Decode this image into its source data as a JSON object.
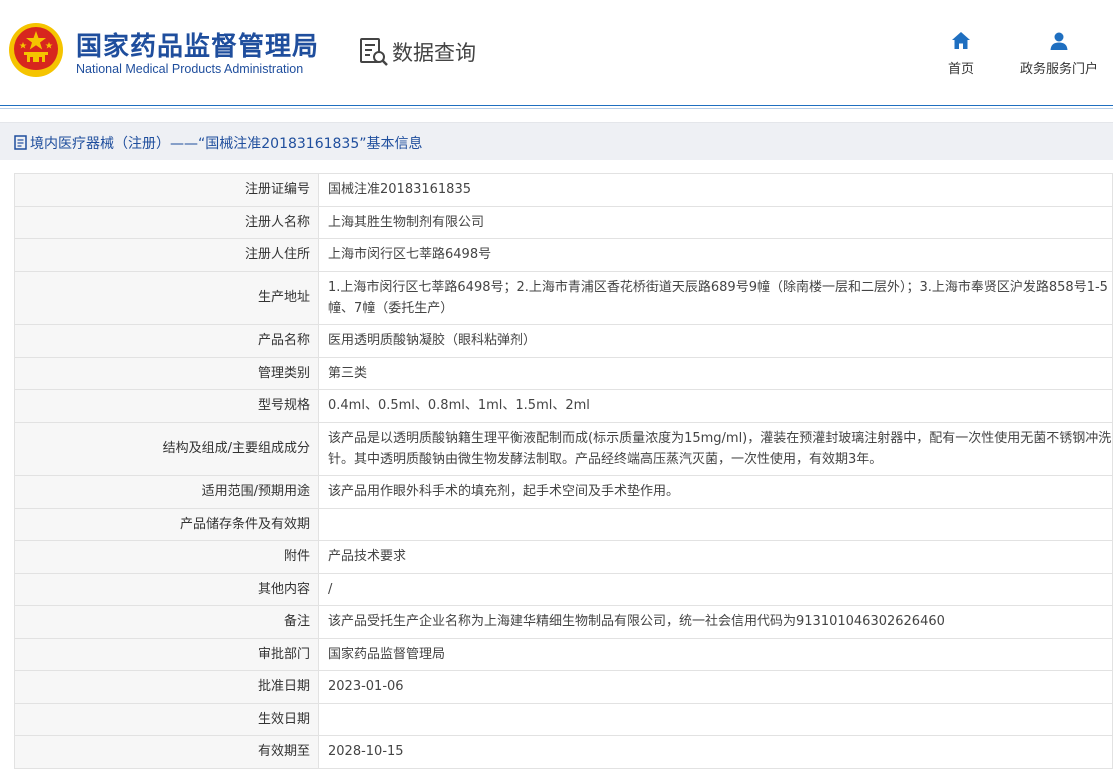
{
  "header": {
    "site_title_cn": "国家药品监督管理局",
    "site_title_en": "National Medical Products Administration",
    "query_label": "数据查询",
    "nav": {
      "home_label": "首页",
      "portal_label": "政务服务门户"
    }
  },
  "colors": {
    "brand_blue": "#1f4e9d",
    "emblem_red": "#d7261e",
    "emblem_gold": "#f5c400",
    "nav_icon_blue": "#1f6fc0"
  },
  "icons": {
    "emblem": "national-emblem-icon",
    "query": "document-search-icon",
    "home": "home-icon",
    "portal": "user-icon",
    "title": "document-icon"
  },
  "breadcrumb": {
    "text": "境内医疗器械（注册）——“国械注准20183161835”基本信息"
  },
  "details": [
    {
      "label": "注册证编号",
      "value": "国械注准20183161835"
    },
    {
      "label": "注册人名称",
      "value": "上海其胜生物制剂有限公司"
    },
    {
      "label": "注册人住所",
      "value": "上海市闵行区七莘路6498号"
    },
    {
      "label": "生产地址",
      "value": "1.上海市闵行区七莘路6498号；2.上海市青浦区香花桥街道天辰路689号9幢（除南楼一层和二层外）；3.上海市奉贤区沪发路858号1-5幢、7幢（委托生产）"
    },
    {
      "label": "产品名称",
      "value": "医用透明质酸钠凝胶（眼科粘弹剂）"
    },
    {
      "label": "管理类别",
      "value": "第三类"
    },
    {
      "label": "型号规格",
      "value": "0.4ml、0.5ml、0.8ml、1ml、1.5ml、2ml"
    },
    {
      "label": "结构及组成/主要组成成分",
      "value": "该产品是以透明质酸钠籍生理平衡液配制而成(标示质量浓度为15mg/ml)，灌装在预灌封玻璃注射器中，配有一次性使用无菌不锈钢冲洗针。其中透明质酸钠由微生物发酵法制取。产品经终端高压蒸汽灭菌，一次性使用，有效期3年。"
    },
    {
      "label": "适用范围/预期用途",
      "value": "该产品用作眼外科手术的填充剂，起手术空间及手术垫作用。"
    },
    {
      "label": "产品储存条件及有效期",
      "value": ""
    },
    {
      "label": "附件",
      "value": "产品技术要求"
    },
    {
      "label": "其他内容",
      "value": "/"
    },
    {
      "label": "备注",
      "value": "该产品受托生产企业名称为上海建华精细生物制品有限公司，统一社会信用代码为913101046302626460"
    },
    {
      "label": "审批部门",
      "value": "国家药品监督管理局"
    },
    {
      "label": "批准日期",
      "value": "2023-01-06"
    },
    {
      "label": "生效日期",
      "value": ""
    },
    {
      "label": "有效期至",
      "value": "2028-10-15"
    }
  ]
}
